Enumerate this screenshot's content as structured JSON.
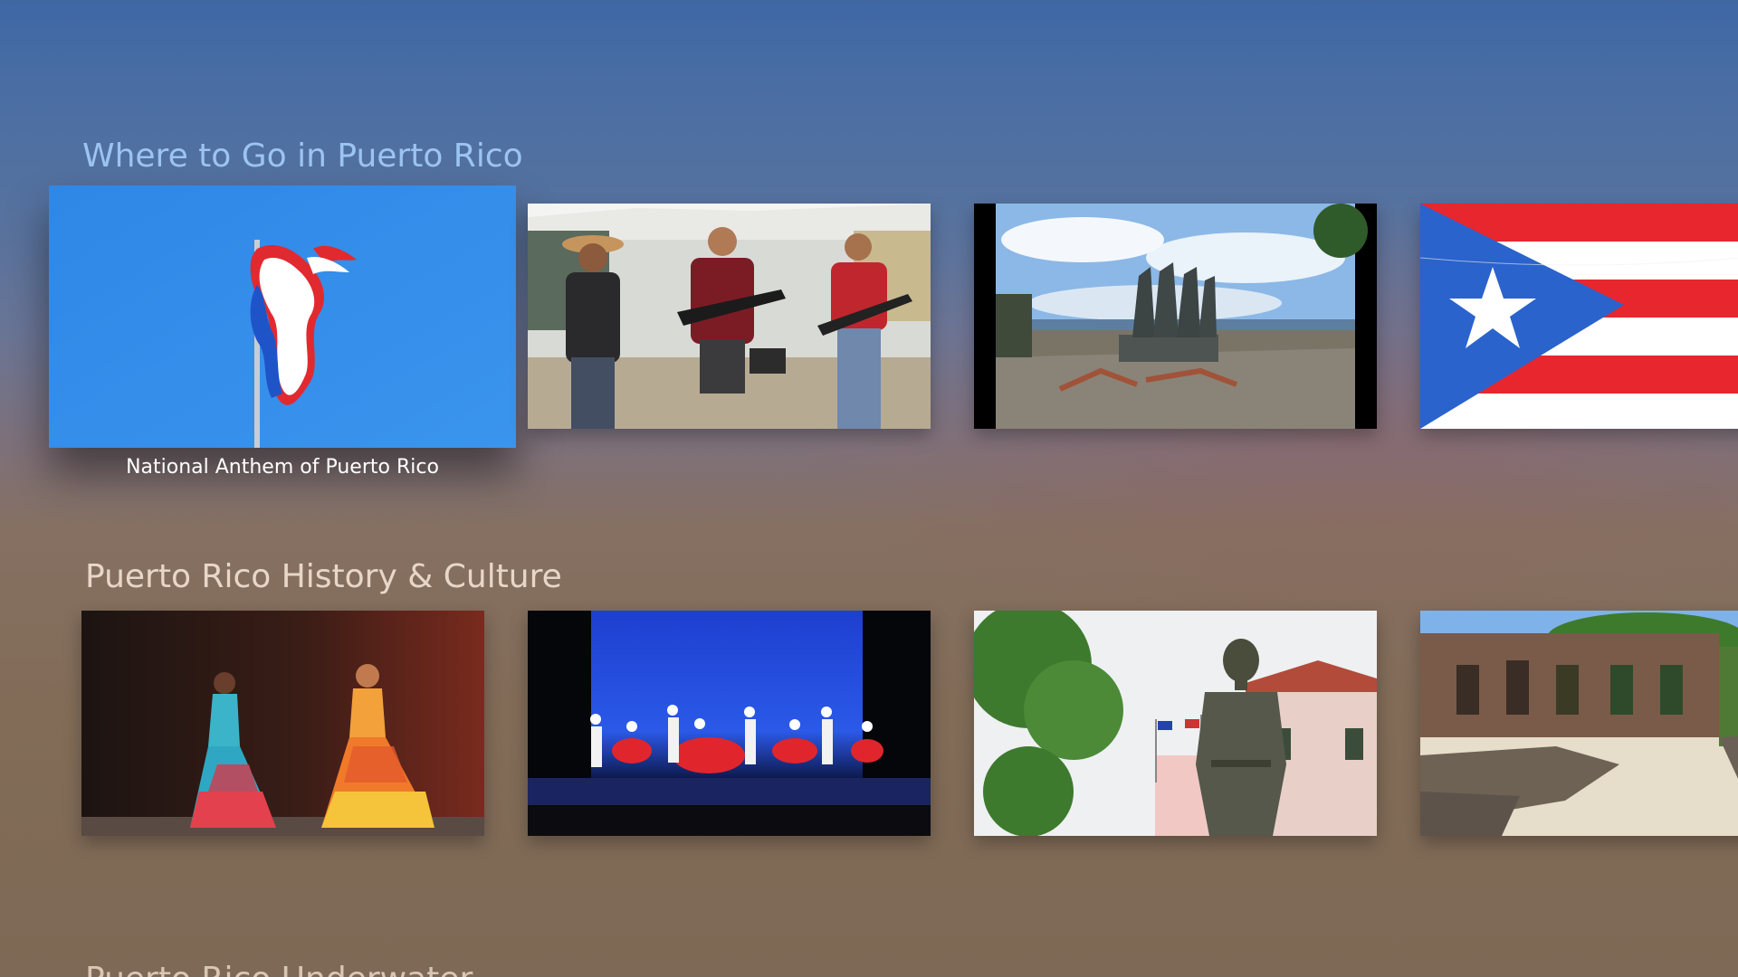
{
  "theme": {
    "row1_title_color": "#9cc4f2",
    "row2_title_color": "#e8d7c9",
    "row3_title_color": "#d9c6b5"
  },
  "rows": [
    {
      "title": "Where to Go in Puerto Rico",
      "items": [
        {
          "caption": "National Anthem of Puerto Rico",
          "thumbnail": "flag-waving-blue-sky",
          "focused": true
        },
        {
          "caption": "",
          "thumbnail": "guitar-band-under-tent"
        },
        {
          "caption": "",
          "thumbnail": "la-rogativa-statue-plaza"
        },
        {
          "caption": "",
          "thumbnail": "puerto-rico-flag-closeup"
        }
      ]
    },
    {
      "title": "Puerto Rico History & Culture",
      "items": [
        {
          "caption": "",
          "thumbnail": "dancers-ruffled-dresses"
        },
        {
          "caption": "",
          "thumbnail": "folk-dance-stage-blue"
        },
        {
          "caption": "",
          "thumbnail": "bronze-statue-plaza"
        },
        {
          "caption": "",
          "thumbnail": "stone-ruins-courtyard"
        }
      ]
    },
    {
      "title": "Puerto Rico Underwater"
    }
  ]
}
